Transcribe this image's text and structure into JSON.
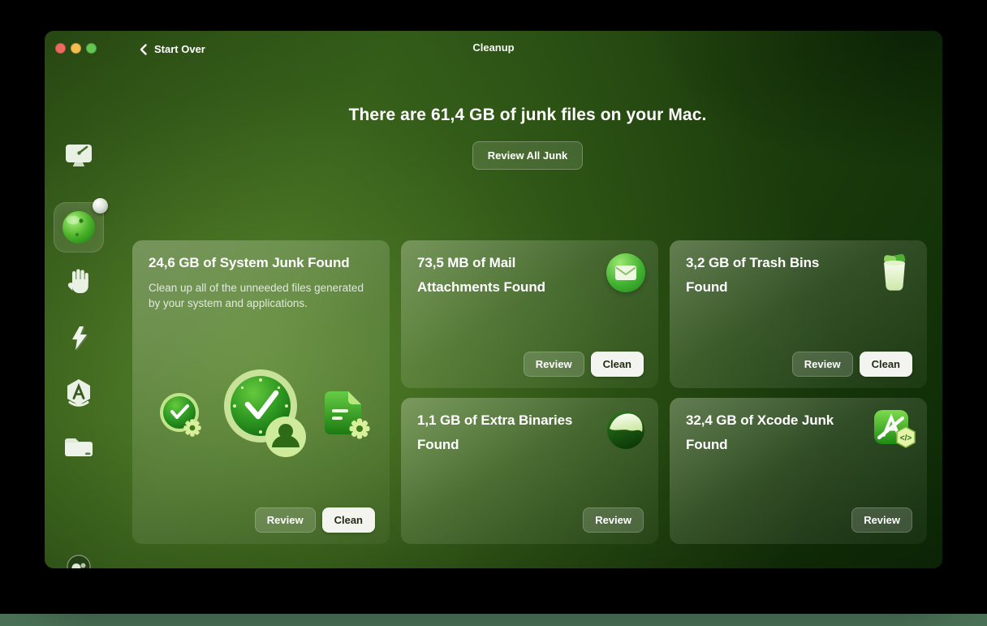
{
  "window": {
    "titlebar": {
      "back_label": "Start Over",
      "title": "Cleanup",
      "traffic_lights": [
        "close",
        "minimize",
        "zoom"
      ]
    }
  },
  "hero": {
    "heading": "There are 61,4 GB of junk files on your Mac.",
    "review_all_label": "Review All Junk"
  },
  "sidebar": {
    "items": [
      {
        "name": "smart-care",
        "icon": "monitor-gauge-icon",
        "selected": false
      },
      {
        "name": "cleanup",
        "icon": "cleanup-orb-icon",
        "selected": true,
        "has_badge": true
      },
      {
        "name": "protection",
        "icon": "hand-icon",
        "selected": false
      },
      {
        "name": "performance",
        "icon": "lightning-icon",
        "selected": false
      },
      {
        "name": "applications",
        "icon": "app-seal-icon",
        "selected": false
      },
      {
        "name": "my-clutter",
        "icon": "folder-icon",
        "selected": false
      }
    ],
    "footer": {
      "name": "assistant",
      "icon": "assistant-orb-icon"
    }
  },
  "cards": [
    {
      "title": "24,6 GB of System Junk Found",
      "description": "Clean up all of the unneeded files generated by your system and applications.",
      "icon": "clocks-and-documents-illustration",
      "review_label": "Review",
      "clean_label": "Clean"
    },
    {
      "title": "73,5 MB of Mail Attachments Found",
      "icon": "mail-icon",
      "review_label": "Review",
      "clean_label": "Clean"
    },
    {
      "title": "3,2 GB of Trash Bins Found",
      "icon": "trash-bin-icon",
      "review_label": "Review",
      "clean_label": "Clean"
    },
    {
      "title": "1,1 GB of Extra Binaries Found",
      "icon": "binaries-orb-icon",
      "review_label": "Review"
    },
    {
      "title": "32,4 GB of Xcode Junk Found",
      "icon": "xcode-icon",
      "review_label": "Review"
    }
  ],
  "colors": {
    "window_green_bright": "#4a7428",
    "window_green_dark": "#0d2b06",
    "card_overlay": "rgba(240,248,230,0.2)",
    "clean_button_bg": "#f3f4ef",
    "clean_button_text": "#1f2b16",
    "traffic_red": "#ee6a5f",
    "traffic_yellow": "#f5bd4f",
    "traffic_green": "#62c554",
    "bottom_strip": "#4a7156"
  }
}
